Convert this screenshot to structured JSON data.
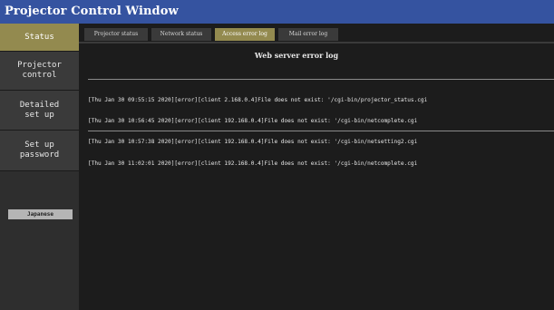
{
  "window": {
    "title": "Projector Control Window"
  },
  "sidebar": {
    "items": [
      {
        "label": "Status",
        "active": true
      },
      {
        "label": "Projector\ncontrol",
        "active": false
      },
      {
        "label": "Detailed\nset up",
        "active": false
      },
      {
        "label": "Set up\npassword",
        "active": false
      }
    ],
    "language_button": "Japanese"
  },
  "tabs": [
    {
      "label": "Projector status",
      "active": false
    },
    {
      "label": "Network status",
      "active": false
    },
    {
      "label": "Access error log",
      "active": true
    },
    {
      "label": "Mail error log",
      "active": false
    }
  ],
  "main": {
    "heading": "Web server error log",
    "log_lines": [
      "[Thu Jan 30 09:55:15 2020][error][client 2.168.0.4]File does not exist: '/cgi-bin/projector_status.cgi",
      "[Thu Jan 30 10:56:45 2020][error][client 192.168.0.4]File does not exist: '/cgi-bin/netcomplete.cgi",
      "[Thu Jan 30 10:57:38 2020][error][client 192.168.0.4]File does not exist: '/cgi-bin/netsetting2.cgi",
      "[Thu Jan 30 11:02:01 2020][error][client 192.168.0.4]File does not exist: '/cgi-bin/netcomplete.cgi"
    ]
  },
  "colors": {
    "titlebar": "#3553a0",
    "active_accent": "#938a4f",
    "background": "#1c1c1c"
  }
}
